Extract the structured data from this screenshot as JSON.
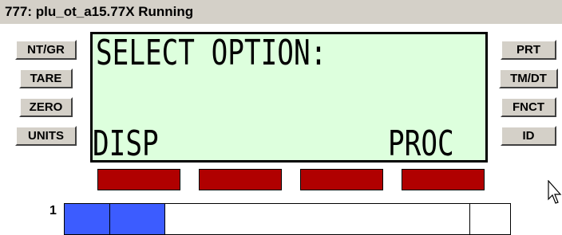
{
  "window": {
    "title": "777: plu_ot_a15.77X Running"
  },
  "left_buttons": [
    {
      "label": "NT/GR"
    },
    {
      "label": "TARE"
    },
    {
      "label": "ZERO"
    },
    {
      "label": "UNITS"
    }
  ],
  "right_buttons": [
    {
      "label": "PRT"
    },
    {
      "label": "TM/DT"
    },
    {
      "label": "FNCT"
    },
    {
      "label": "ID"
    }
  ],
  "display": {
    "line1": "SELECT OPTION:",
    "softkey_left": "DISP",
    "softkey_right": "PROC"
  },
  "softkeys": {
    "count": 4,
    "color": "#b00000"
  },
  "status_row": {
    "label": "1",
    "fill_color": "#3c5cff"
  },
  "colors": {
    "lcd_background": "#ddffdd",
    "panel": "#d4d0c8"
  }
}
